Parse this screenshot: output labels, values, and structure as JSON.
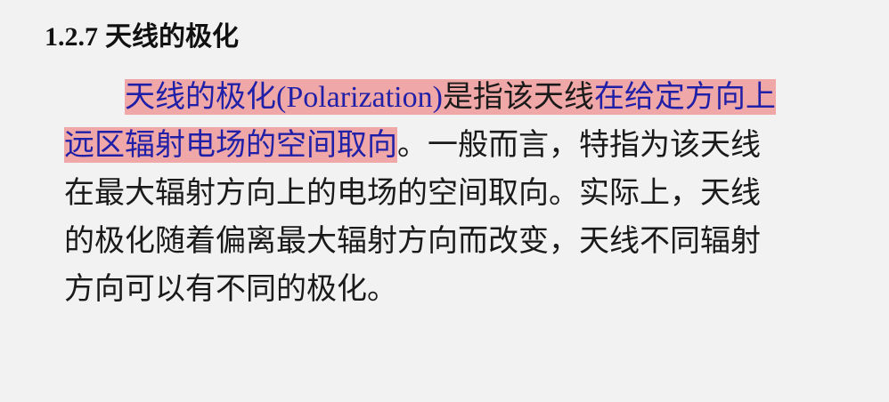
{
  "section": {
    "number": "1.2.7",
    "title": "天线的极化"
  },
  "paragraph": {
    "line1": {
      "term": "天线的极化",
      "term_latin": "(Polarization)",
      "is_text": "是指该天线",
      "def_part1": "在给定方向上"
    },
    "line2": {
      "def_part2": "远区辐射电场的空间取向",
      "rest": "。一般而言，特指为该天线"
    },
    "line3": "在最大辐射方向上的电场的空间取向。实际上，天线",
    "line4": "的极化随着偏离最大辐射方向而改变，天线不同辐射",
    "line5": "方向可以有不同的极化。"
  },
  "colors": {
    "highlight": "#f0a7a7",
    "highlight_text": "#1f1fa8",
    "text": "#1a1a1a",
    "background": "#f2f2f2"
  }
}
